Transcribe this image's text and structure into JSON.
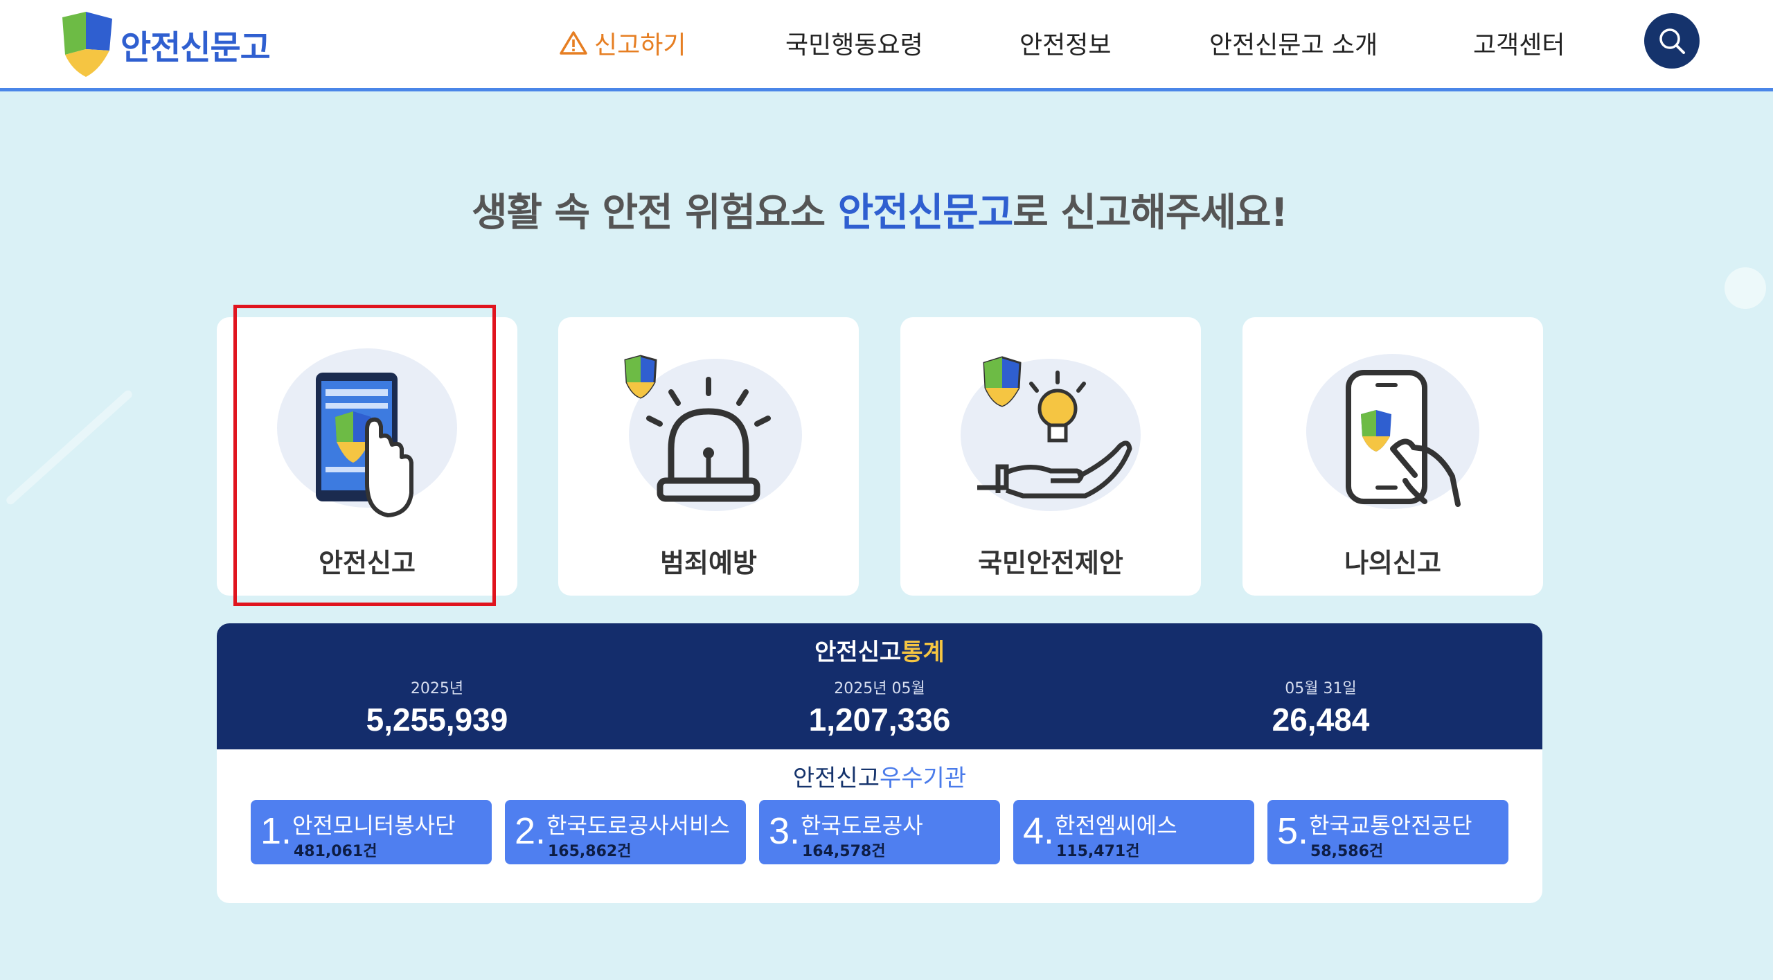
{
  "header": {
    "logo_text": "안전신문고",
    "nav": [
      {
        "label": "신고하기"
      },
      {
        "label": "국민행동요령"
      },
      {
        "label": "안전정보"
      },
      {
        "label": "안전신문고 소개"
      },
      {
        "label": "고객센터"
      }
    ]
  },
  "headline": {
    "prefix": "생활 속 안전 위험요소 ",
    "highlight": "안전신문고",
    "suffix": "로 신고해주세요!"
  },
  "cards": [
    {
      "label": "안전신고"
    },
    {
      "label": "범죄예방"
    },
    {
      "label": "국민안전제안"
    },
    {
      "label": "나의신고"
    }
  ],
  "stats": {
    "title_main": "안전신고",
    "title_accent": "통계",
    "items": [
      {
        "sub": "2025년",
        "value": "5,255,939"
      },
      {
        "sub": "2025년 05월",
        "value": "1,207,336"
      },
      {
        "sub": "05월 31일",
        "value": "26,484"
      }
    ],
    "org_title_main": "안전신고",
    "org_title_accent": "우수기관",
    "orgs": [
      {
        "rank": "1.",
        "name": "안전모니터봉사단",
        "count": "481,061건"
      },
      {
        "rank": "2.",
        "name": "한국도로공사서비스",
        "count": "165,862건"
      },
      {
        "rank": "3.",
        "name": "한국도로공사",
        "count": "164,578건"
      },
      {
        "rank": "4.",
        "name": "한전엠씨에스",
        "count": "115,471건"
      },
      {
        "rank": "5.",
        "name": "한국교통안전공단",
        "count": "58,586건"
      }
    ]
  },
  "colors": {
    "brand_blue": "#2f5fd0",
    "navy": "#142d6c",
    "accent_orange": "#e67e22",
    "accent_yellow": "#f5c542",
    "highlight_red": "#e0141e"
  }
}
